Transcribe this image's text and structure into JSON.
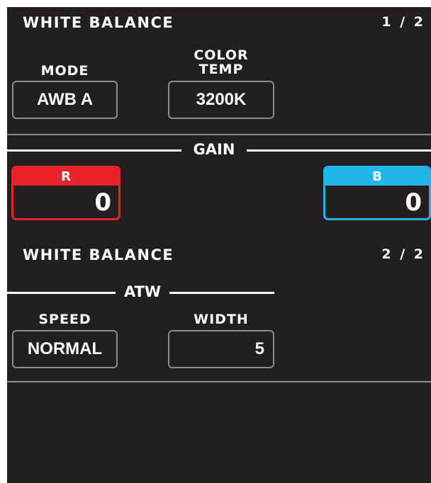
{
  "panel1": {
    "title": "WHITE BALANCE",
    "page": "1 / 2",
    "mode": {
      "label": "MODE",
      "value": "AWB A"
    },
    "color_temp": {
      "label_line1": "COLOR",
      "label_line2": "TEMP",
      "value": "3200K"
    },
    "gain": {
      "label": "GAIN",
      "r": {
        "label": "R",
        "value": "0",
        "color": "#e8232a"
      },
      "b": {
        "label": "B",
        "value": "0",
        "color": "#22b5e8"
      }
    }
  },
  "panel2": {
    "title": "WHITE BALANCE",
    "page": "2 / 2",
    "atw": {
      "label": "ATW",
      "speed": {
        "label": "SPEED",
        "value": "NORMAL"
      },
      "width": {
        "label": "WIDTH",
        "value": "5"
      }
    }
  },
  "colors": {
    "background": "#231f20",
    "text": "#ffffff",
    "box_border": "#8c8c8c"
  }
}
